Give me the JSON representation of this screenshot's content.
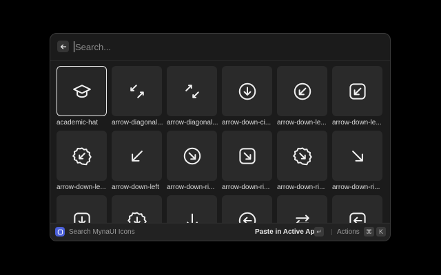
{
  "search": {
    "placeholder": "Search..."
  },
  "icons": [
    {
      "label": "academic-hat",
      "icon": "academic-hat-icon"
    },
    {
      "label": "arrow-diagonal...",
      "icon": "arrow-diagonal-in-icon"
    },
    {
      "label": "arrow-diagonal...",
      "icon": "arrow-diagonal-out-icon"
    },
    {
      "label": "arrow-down-ci...",
      "icon": "arrow-down-circle-icon"
    },
    {
      "label": "arrow-down-le...",
      "icon": "arrow-down-left-circle-icon"
    },
    {
      "label": "arrow-down-le...",
      "icon": "arrow-down-left-square-icon"
    },
    {
      "label": "arrow-down-le...",
      "icon": "arrow-down-left-badge-icon"
    },
    {
      "label": "arrow-down-left",
      "icon": "arrow-down-left-icon"
    },
    {
      "label": "arrow-down-ri...",
      "icon": "arrow-down-right-circle-icon"
    },
    {
      "label": "arrow-down-ri...",
      "icon": "arrow-down-right-square-icon"
    },
    {
      "label": "arrow-down-ri...",
      "icon": "arrow-down-right-badge-icon"
    },
    {
      "label": "arrow-down-ri...",
      "icon": "arrow-down-right-icon"
    },
    {
      "label": "",
      "icon": "arrow-down-square-icon"
    },
    {
      "label": "",
      "icon": "arrow-down-badge-icon"
    },
    {
      "label": "",
      "icon": "arrow-down-icon"
    },
    {
      "label": "",
      "icon": "arrow-left-circle-icon"
    },
    {
      "label": "",
      "icon": "arrow-left-right-icon"
    },
    {
      "label": "",
      "icon": "arrow-left-square-icon"
    }
  ],
  "footer": {
    "title": "Search MynaUI Icons",
    "primary_action": "Paste in Active App",
    "enter_key": "↵",
    "actions_label": "Actions",
    "cmd_key": "⌘",
    "k_key": "K"
  }
}
